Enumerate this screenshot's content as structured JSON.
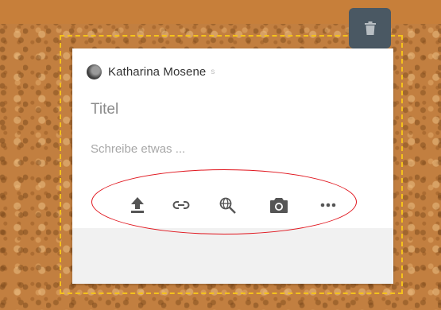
{
  "card": {
    "author_name": "Katharina Mosene",
    "author_badge": "s",
    "title_placeholder": "Titel",
    "body_placeholder": "Schreibe etwas ..."
  },
  "toolbar": {
    "items": [
      {
        "icon": "upload-icon"
      },
      {
        "icon": "link-icon"
      },
      {
        "icon": "web-search-icon"
      },
      {
        "icon": "camera-icon"
      },
      {
        "icon": "more-icon"
      }
    ]
  },
  "colors": {
    "trash_button": "#4a5863",
    "highlight": "#e0141c",
    "selection_border": "#f4c21c",
    "icon": "#555555"
  }
}
